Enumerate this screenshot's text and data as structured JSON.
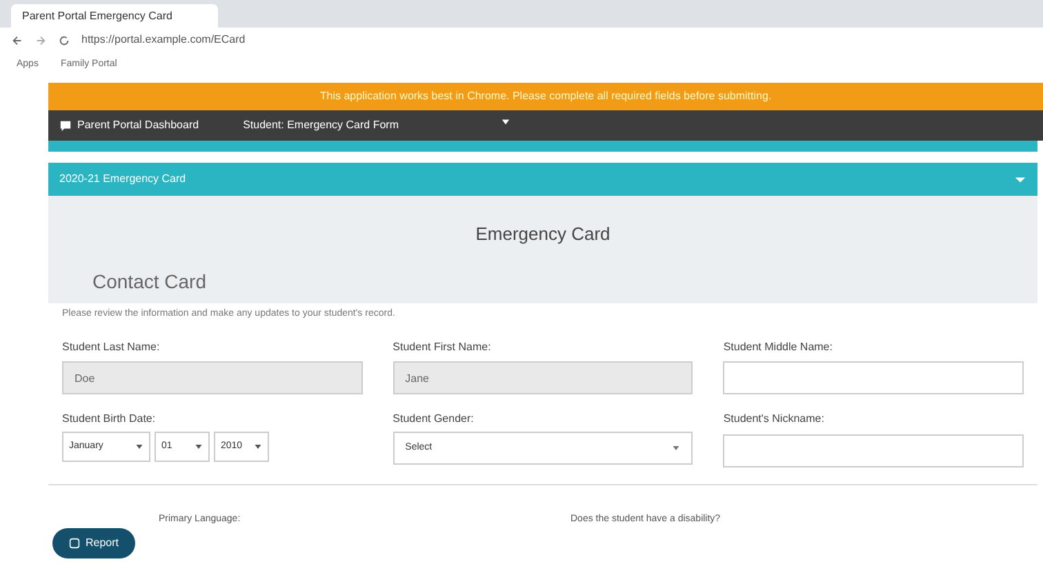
{
  "browser": {
    "tab_title": "Parent Portal Emergency Card",
    "address": "https://portal.example.com/ECard",
    "bookmarks": [
      "Apps",
      "Family Portal"
    ]
  },
  "banner": "This application works best in Chrome. Please complete all required fields before submitting.",
  "nav": {
    "brand": "Parent Portal Dashboard",
    "student": "Student: Emergency Card Form"
  },
  "section": {
    "title": "2020-21 Emergency Card",
    "expanded": true
  },
  "card_title": "Emergency Card",
  "subtitle": "Contact Card",
  "instructions": "Please review the information and make any updates to your student's record.",
  "rows": [
    [
      {
        "kind": "text",
        "label": "Student Last Name:",
        "value": "Doe",
        "disabled": true
      },
      {
        "kind": "text",
        "label": "Student First Name:",
        "value": "Jane",
        "disabled": true
      },
      {
        "kind": "text",
        "label": "Student Middle Name:",
        "disabled": false
      }
    ],
    [
      {
        "kind": "date",
        "label": "Student Birth Date:",
        "parts": [
          "January",
          "01",
          "2010"
        ]
      },
      {
        "kind": "select",
        "label": "Student Gender:",
        "value": "Select"
      },
      {
        "kind": "text",
        "label": "Student's Nickname:",
        "disabled": false
      }
    ]
  ],
  "bottom": {
    "left_label": "Primary Language:",
    "right_label": "Does the student have a disability?"
  },
  "report_button": "Report"
}
